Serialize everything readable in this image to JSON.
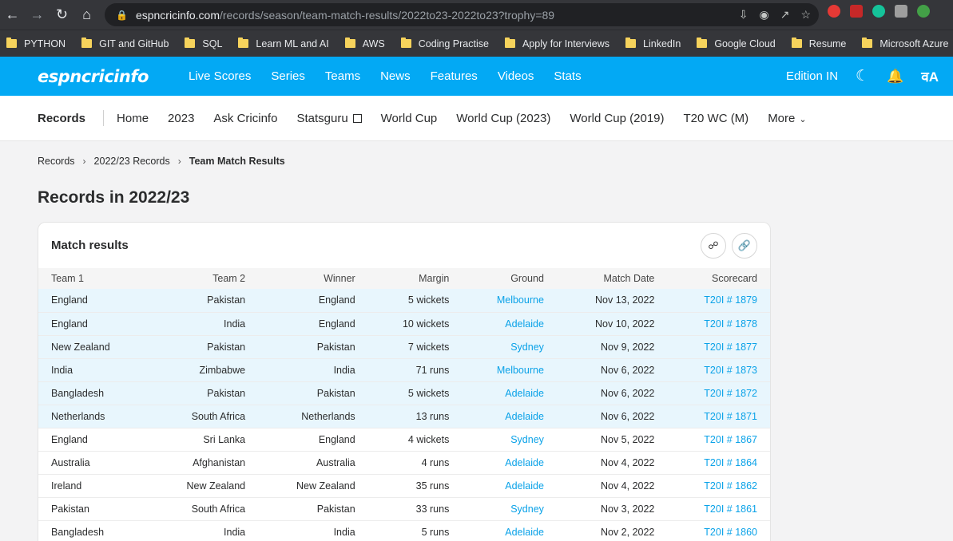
{
  "browser": {
    "url_host": "espncricinfo.com",
    "url_path": "/records/season/team-match-results/2022to23-2022to23?trophy=89",
    "bookmarks": [
      "PYTHON",
      "GIT and GitHub",
      "SQL",
      "Learn ML and AI",
      "AWS",
      "Coding Practise",
      "Apply for Interviews",
      "LinkedIn",
      "Google Cloud",
      "Resume",
      "Microsoft Azure"
    ]
  },
  "header": {
    "logo": "espncricinfo",
    "nav": [
      "Live Scores",
      "Series",
      "Teams",
      "News",
      "Features",
      "Videos",
      "Stats"
    ],
    "edition": "Edition IN",
    "lang_icon": "वA",
    "brand_color": "#03a9f4"
  },
  "subnav": {
    "title": "Records",
    "links": [
      "Home",
      "2023",
      "Ask Cricinfo",
      "Statsguru",
      "World Cup",
      "World Cup (2023)",
      "World Cup (2019)",
      "T20 WC (M)"
    ],
    "more": "More"
  },
  "breadcrumb": [
    "Records",
    "2022/23 Records",
    "Team Match Results"
  ],
  "page_title": "Records in 2022/23",
  "card": {
    "title": "Match results",
    "columns": [
      "Team 1",
      "Team 2",
      "Winner",
      "Margin",
      "Ground",
      "Match Date",
      "Scorecard"
    ],
    "rows": [
      [
        "England",
        "Pakistan",
        "England",
        "5 wickets",
        "Melbourne",
        "Nov 13, 2022",
        "T20I # 1879"
      ],
      [
        "England",
        "India",
        "England",
        "10 wickets",
        "Adelaide",
        "Nov 10, 2022",
        "T20I # 1878"
      ],
      [
        "New Zealand",
        "Pakistan",
        "Pakistan",
        "7 wickets",
        "Sydney",
        "Nov 9, 2022",
        "T20I # 1877"
      ],
      [
        "India",
        "Zimbabwe",
        "India",
        "71 runs",
        "Melbourne",
        "Nov 6, 2022",
        "T20I # 1873"
      ],
      [
        "Bangladesh",
        "Pakistan",
        "Pakistan",
        "5 wickets",
        "Adelaide",
        "Nov 6, 2022",
        "T20I # 1872"
      ],
      [
        "Netherlands",
        "South Africa",
        "Netherlands",
        "13 runs",
        "Adelaide",
        "Nov 6, 2022",
        "T20I # 1871"
      ],
      [
        "England",
        "Sri Lanka",
        "England",
        "4 wickets",
        "Sydney",
        "Nov 5, 2022",
        "T20I # 1867"
      ],
      [
        "Australia",
        "Afghanistan",
        "Australia",
        "4 runs",
        "Adelaide",
        "Nov 4, 2022",
        "T20I # 1864"
      ],
      [
        "Ireland",
        "New Zealand",
        "New Zealand",
        "35 runs",
        "Adelaide",
        "Nov 4, 2022",
        "T20I # 1862"
      ],
      [
        "Pakistan",
        "South Africa",
        "Pakistan",
        "33 runs",
        "Sydney",
        "Nov 3, 2022",
        "T20I # 1861"
      ],
      [
        "Bangladesh",
        "India",
        "India",
        "5 runs",
        "Adelaide",
        "Nov 2, 2022",
        "T20I # 1860"
      ]
    ],
    "highlighted_rows": 6,
    "link_color": "#0aa2e8"
  }
}
